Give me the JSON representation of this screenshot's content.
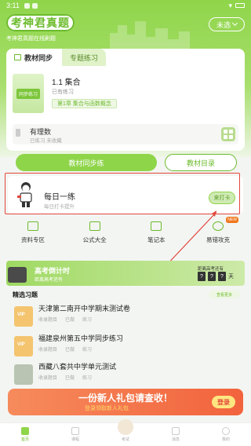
{
  "status_bar": {
    "time": "3:11"
  },
  "header": {
    "logo": "考神君真题",
    "slogan": "考神君真题在线刷题",
    "grade_select": "未选"
  },
  "tabs": [
    {
      "label": "教材同步"
    },
    {
      "label": "专题练习"
    }
  ],
  "textbook": {
    "cover_label": "同步练习",
    "title": "1.1 集合",
    "subtitle": "已有练习",
    "chapter_chip": "第1章 集合与函数概念"
  },
  "subject_row": {
    "title": "有理数",
    "subtitle": "已练习 未收藏"
  },
  "buttons": {
    "practice": "教材同步练",
    "contents": "教材目录"
  },
  "daily": {
    "title": "每日一练",
    "subtitle": "每日打卡提升",
    "checkin": "来打卡"
  },
  "quick_actions": [
    {
      "label": "资料专区",
      "icon": "folder-icon"
    },
    {
      "label": "公式大全",
      "icon": "formula-icon"
    },
    {
      "label": "笔记本",
      "icon": "notebook-icon"
    },
    {
      "label": "易错攻克",
      "icon": "target-icon",
      "badge": "NEW"
    }
  ],
  "countdown": {
    "title": "高考倒计时",
    "subtitle": "距离高考还有",
    "label": "距离高考还有",
    "digits": [
      "?",
      "?",
      "?"
    ],
    "unit": "天"
  },
  "selected": {
    "title": "精选习题",
    "more": "查看更多"
  },
  "papers": [
    {
      "title": "天津第二南开中学期末测试卷",
      "meta": [
        "收录题目",
        "已做",
        "练习"
      ]
    },
    {
      "title": "福建泉州第五中学同步练习",
      "meta": [
        "收录题目",
        "已做",
        "练习"
      ]
    },
    {
      "title": "西藏八套共中学单元测试",
      "meta": [
        "收录题目",
        "已做",
        "练习"
      ]
    }
  ],
  "banner": {
    "text": "一份新人礼包请查收！",
    "subtitle": "登录领取新人礼包",
    "button": "登录"
  },
  "tabbar": [
    {
      "label": "首页",
      "active": true
    },
    {
      "label": "课程",
      "active": false
    },
    {
      "label": "考试",
      "active": false
    },
    {
      "label": "消息",
      "active": false
    },
    {
      "label": "我的",
      "active": false
    }
  ],
  "colors": {
    "brand": "#8fd54a",
    "highlight": "#e2473d"
  }
}
